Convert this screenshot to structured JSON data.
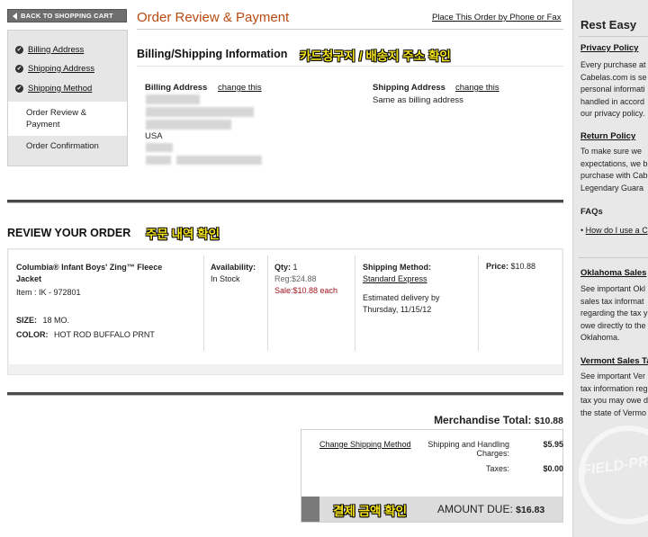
{
  "nav": {
    "back_to_cart": "BACK TO SHOPPING CART",
    "steps": [
      {
        "label": "Billing Address",
        "done": true
      },
      {
        "label": "Shipping Address",
        "done": true
      },
      {
        "label": "Shipping Method",
        "done": true
      }
    ],
    "current_step": "Order Review & Payment",
    "next_step": "Order Confirmation"
  },
  "header": {
    "title": "Order Review & Payment",
    "phone_fax_link": "Place This Order by Phone or Fax"
  },
  "billing": {
    "section_title": "Billing/Shipping Information",
    "note_ko": "카드청구지 / 배송지 주소 확인",
    "billing_label": "Billing Address",
    "billing_change": "change this",
    "billing_country": "USA",
    "shipping_label": "Shipping Address",
    "shipping_change": "change this",
    "shipping_value": "Same as billing address"
  },
  "order": {
    "section_title": "REVIEW YOUR ORDER",
    "note_ko": "주문 내역 확인",
    "item": {
      "name_line1": "Columbia® Infant Boys' Zing™ Fleece",
      "name_line2": "Jacket",
      "item_number": "Item : IK - 972801",
      "size_label": "SIZE:",
      "size_value": "18 MO.",
      "color_label": "COLOR:",
      "color_value": "HOT ROD BUFFALO PRNT",
      "availability_label": "Availability:",
      "availability_value": "In Stock",
      "qty_label": "Qty:",
      "qty_value": "1",
      "reg_price": "Reg:$24.88",
      "sale_price": "Sale:$10.88 each",
      "shipping_method_label": "Shipping Method:",
      "shipping_method_value": "Standard Express",
      "delivery_line1": "Estimated delivery by",
      "delivery_line2": "Thursday, 11/15/12",
      "price_label": "Price:",
      "price_value": "$10.88"
    }
  },
  "totals": {
    "merch_label": "Merchandise Total:",
    "merch_value": "$10.88",
    "change_shipping": "Change Shipping Method",
    "shipping_label_1": "Shipping and Handling",
    "shipping_label_2": "Charges:",
    "shipping_value": "$5.95",
    "taxes_label": "Taxes:",
    "taxes_value": "$0.00",
    "note_ko": "결제 금액 확인",
    "amount_due_label": "AMOUNT DUE:",
    "amount_due_value": "$16.83"
  },
  "sidebar": {
    "title": "Rest Easy",
    "privacy_title": "Privacy Policy",
    "privacy_lines": [
      "Every purchase at",
      "Cabelas.com is se",
      "personal informati",
      "handled in accord",
      "our privacy policy."
    ],
    "return_title": "Return Policy",
    "return_lines": [
      "To make sure we",
      "expectations, we b",
      "purchase with Cab",
      "Legendary Guara"
    ],
    "faqs_title": "FAQs",
    "faq_link": "How do I use a C",
    "ok_title": "Oklahoma Sales",
    "ok_lines": [
      "See important Okl",
      "sales tax informat",
      "regarding the tax y",
      "owe directly to the",
      "Oklahoma."
    ],
    "vt_title": "Vermont Sales Ta",
    "vt_lines": [
      "See important Ver",
      "tax information reg",
      "tax you may owe d",
      "the state of Vermo"
    ],
    "stamp_text": "FIELD-PR"
  }
}
